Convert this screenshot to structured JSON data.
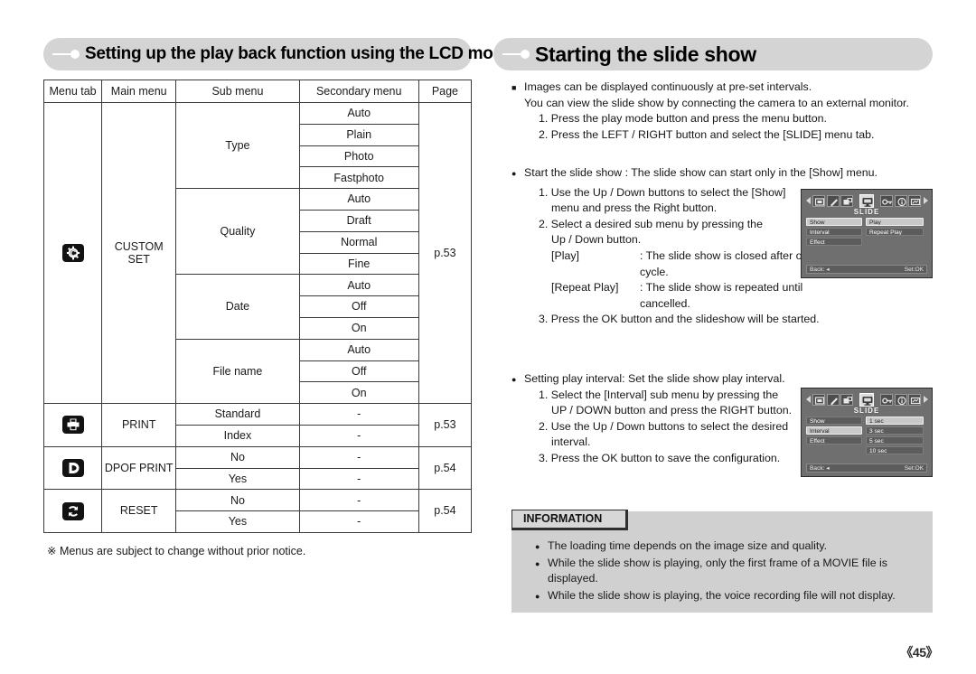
{
  "headers": {
    "left": "Setting up the play back function using the LCD monitor",
    "right": "Starting the slide show"
  },
  "table": {
    "columns": [
      "Menu tab",
      "Main menu",
      "Sub menu",
      "Secondary menu",
      "Page"
    ],
    "groups": [
      {
        "icon": "custom-set-icon",
        "main_menu": "CUSTOM\nSET",
        "main_menu_line1": "CUSTOM",
        "main_menu_line2": "SET",
        "page": "p.53",
        "subs": [
          {
            "label": "Type",
            "secondary": [
              "Auto",
              "Plain",
              "Photo",
              "Fastphoto"
            ]
          },
          {
            "label": "Quality",
            "secondary": [
              "Auto",
              "Draft",
              "Normal",
              "Fine"
            ]
          },
          {
            "label": "Date",
            "secondary": [
              "Auto",
              "Off",
              "On"
            ]
          },
          {
            "label": "File name",
            "secondary": [
              "Auto",
              "Off",
              "On"
            ]
          }
        ]
      },
      {
        "icon": "print-icon",
        "main_menu": "PRINT",
        "page": "p.53",
        "rows": [
          {
            "sub": "Standard",
            "secondary": "-"
          },
          {
            "sub": "Index",
            "secondary": "-"
          }
        ]
      },
      {
        "icon": "dpof-print-icon",
        "main_menu": "DPOF PRINT",
        "page": "p.54",
        "rows": [
          {
            "sub": "No",
            "secondary": "-"
          },
          {
            "sub": "Yes",
            "secondary": "-"
          }
        ]
      },
      {
        "icon": "reset-icon",
        "main_menu": "RESET",
        "page": "p.54",
        "rows": [
          {
            "sub": "No",
            "secondary": "-"
          },
          {
            "sub": "Yes",
            "secondary": "-"
          }
        ]
      }
    ]
  },
  "footnote": "※ Menus are subject to change without prior notice.",
  "right_column": {
    "intro": {
      "line1": "Images can be displayed continuously at pre-set intervals.",
      "line2": "You can view the slide show by connecting the camera to an external monitor.",
      "step1": "1. Press the play mode button and press the menu button.",
      "step2": "2. Press the LEFT / RIGHT button and select the [SLIDE] menu tab."
    },
    "start": {
      "heading": "Start the slide show : The slide show can start only in the [Show] menu.",
      "step1a": "1. Use the Up / Down buttons to select the [Show]",
      "step1b": "menu and press the Right button.",
      "step2a": "2. Select a desired sub menu by pressing the",
      "step2b": "Up / Down button.",
      "play_key": "[Play]",
      "play_val": ": The slide show is closed after one",
      "play_val2": "cycle.",
      "repeat_key": "[Repeat Play]",
      "repeat_val": ": The slide show is repeated until",
      "repeat_val2": "cancelled.",
      "step3": "3. Press the OK button and the slideshow will be started."
    },
    "interval": {
      "heading": "Setting play interval: Set the slide show play interval.",
      "step1a": "1. Select the [Interval] sub menu by pressing the",
      "step1b": "UP / DOWN button and press the RIGHT button.",
      "step2a": "2. Use the Up / Down buttons to select the desired",
      "step2b": "interval.",
      "step3": "3. Press the OK button to save the configuration."
    }
  },
  "lcd_show": {
    "title": "SLIDE",
    "tabs": [
      "picture-icon",
      "pencil-icon",
      "resize-icon",
      "monitor-icon",
      "key-icon",
      "info-icon",
      "screen-icon"
    ],
    "selected_tab_index": 3,
    "left_items": [
      {
        "label": "Show",
        "highlight": true
      },
      {
        "label": "Interval",
        "highlight": false
      },
      {
        "label": "Effect",
        "highlight": false
      }
    ],
    "right_items": [
      {
        "label": "Play",
        "highlight": true
      },
      {
        "label": "Repeat Play",
        "highlight": false
      }
    ],
    "back_label": "Back: ◂",
    "set_label": "Set:OK"
  },
  "lcd_interval": {
    "title": "SLIDE",
    "tabs": [
      "picture-icon",
      "pencil-icon",
      "resize-icon",
      "monitor-icon",
      "key-icon",
      "info-icon",
      "screen-icon"
    ],
    "selected_tab_index": 3,
    "left_items": [
      {
        "label": "Show",
        "highlight": false
      },
      {
        "label": "Interval",
        "highlight": true
      },
      {
        "label": "Effect",
        "highlight": false
      }
    ],
    "right_items": [
      {
        "label": "1 sec",
        "highlight": true
      },
      {
        "label": "3 sec",
        "highlight": false
      },
      {
        "label": "5 sec",
        "highlight": false
      },
      {
        "label": "10 sec",
        "highlight": false
      }
    ],
    "back_label": "Back: ◂",
    "set_label": "Set:OK"
  },
  "information": {
    "title": "INFORMATION",
    "items": [
      "The loading time depends on the image size and quality.",
      "While the slide show is playing, only the first frame of a MOVIE file is",
      "displayed.",
      "While the slide show is playing, the voice recording file will not display."
    ],
    "item1": "The loading time depends on the image size and quality.",
    "item2a": "While the slide show is playing, only the first frame of a MOVIE file is",
    "item2b": "displayed.",
    "item3": "While the slide show is playing, the voice recording file will not display."
  },
  "page_number": "《45》"
}
